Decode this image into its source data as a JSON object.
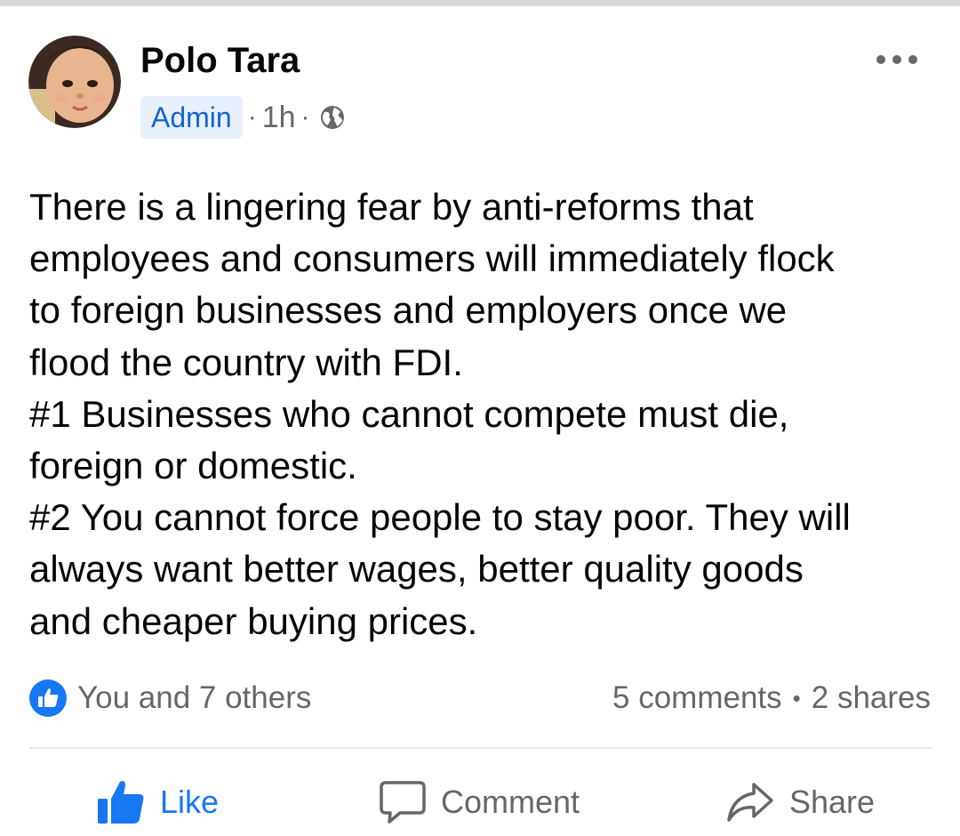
{
  "post": {
    "author": {
      "name": "Polo Tara",
      "avatar_icon": "baby-photo-avatar"
    },
    "role_badge": "Admin",
    "timestamp": "1h",
    "separator": "·",
    "privacy_icon": "globe-icon",
    "menu_icon": "more-options-icon",
    "body_lines": [
      "There is a lingering fear by anti-reforms that",
      "employees and consumers will immediately flock",
      "to foreign businesses and employers once we",
      "flood the country with FDI.",
      "#1 Businesses who cannot compete must die,",
      "foreign or domestic.",
      "#2 You cannot force people to stay poor. They will",
      "always want better wages, better quality goods",
      "and cheaper buying prices."
    ],
    "reactions_text": "You and 7 others",
    "reaction_icon": "like-reaction-icon",
    "comments_count": "5 comments",
    "count_separator": "•",
    "shares_count": "2 shares",
    "actions": {
      "like": "Like",
      "comment": "Comment",
      "share": "Share"
    }
  },
  "colors": {
    "accent_blue": "#1877f2",
    "badge_bg": "#e7f0fc",
    "badge_text": "#1763cf",
    "secondary_text": "#65676b",
    "primary_text": "#050505",
    "divider": "#e4e6eb"
  }
}
